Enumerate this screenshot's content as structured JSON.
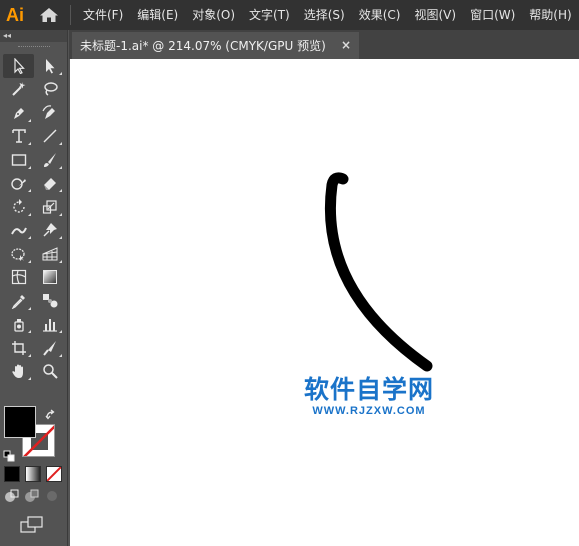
{
  "app": {
    "logo_text": "Ai",
    "home_icon": "home-icon"
  },
  "menu": {
    "items": [
      "文件(F)",
      "编辑(E)",
      "对象(O)",
      "文字(T)",
      "选择(S)",
      "效果(C)",
      "视图(V)",
      "窗口(W)",
      "帮助(H)"
    ]
  },
  "toolbar": {
    "collapse_label": "◂◂",
    "tools": [
      "selection-tool-icon",
      "direct-selection-tool-icon",
      "magic-wand-tool-icon",
      "lasso-tool-icon",
      "pen-tool-icon",
      "curvature-tool-icon",
      "type-tool-icon",
      "line-segment-tool-icon",
      "rectangle-tool-icon",
      "paintbrush-tool-icon",
      "shaper-tool-icon",
      "eraser-tool-icon",
      "rotate-tool-icon",
      "scale-tool-icon",
      "width-tool-icon",
      "puppet-warp-tool-icon",
      "shape-builder-tool-icon",
      "perspective-grid-tool-icon",
      "mesh-tool-icon",
      "gradient-tool-icon",
      "eyedropper-tool-icon",
      "blend-tool-icon",
      "symbol-sprayer-tool-icon",
      "column-graph-tool-icon",
      "artboard-tool-icon",
      "slice-tool-icon",
      "hand-tool-icon",
      "zoom-tool-icon"
    ],
    "fill_color": "#000000",
    "stroke_color": "none"
  },
  "document": {
    "tab_title": "未标题-1.ai* @ 214.07% (CMYK/GPU 预览)",
    "close_label": "×"
  },
  "canvas": {
    "stroke_color": "#000000",
    "watermark_title": "软件自学网",
    "watermark_url": "WWW.RJZXW.COM",
    "watermark_color": "#1a73c9"
  }
}
